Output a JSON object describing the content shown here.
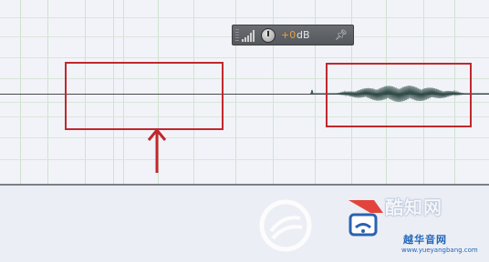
{
  "volume_hud": {
    "value": "+0",
    "unit": "dB",
    "icons": [
      "grip-icon",
      "signal-bars-icon",
      "volume-knob-icon",
      "pin-icon"
    ]
  },
  "colors": {
    "canvas_bg": "#f2f3f9",
    "grid": "#cfe2cf",
    "hud_bg": "#5f6266",
    "hud_value": "#e8a23a",
    "annotation_red": "#c0282d",
    "waveform": "#2f4a46"
  },
  "annotations": [
    "empty-region-box",
    "audio-clip-box",
    "up-arrow"
  ],
  "watermark": {
    "title": "酷知网",
    "subtitle": "越华音网",
    "url": "www.yueyangbang.com"
  }
}
